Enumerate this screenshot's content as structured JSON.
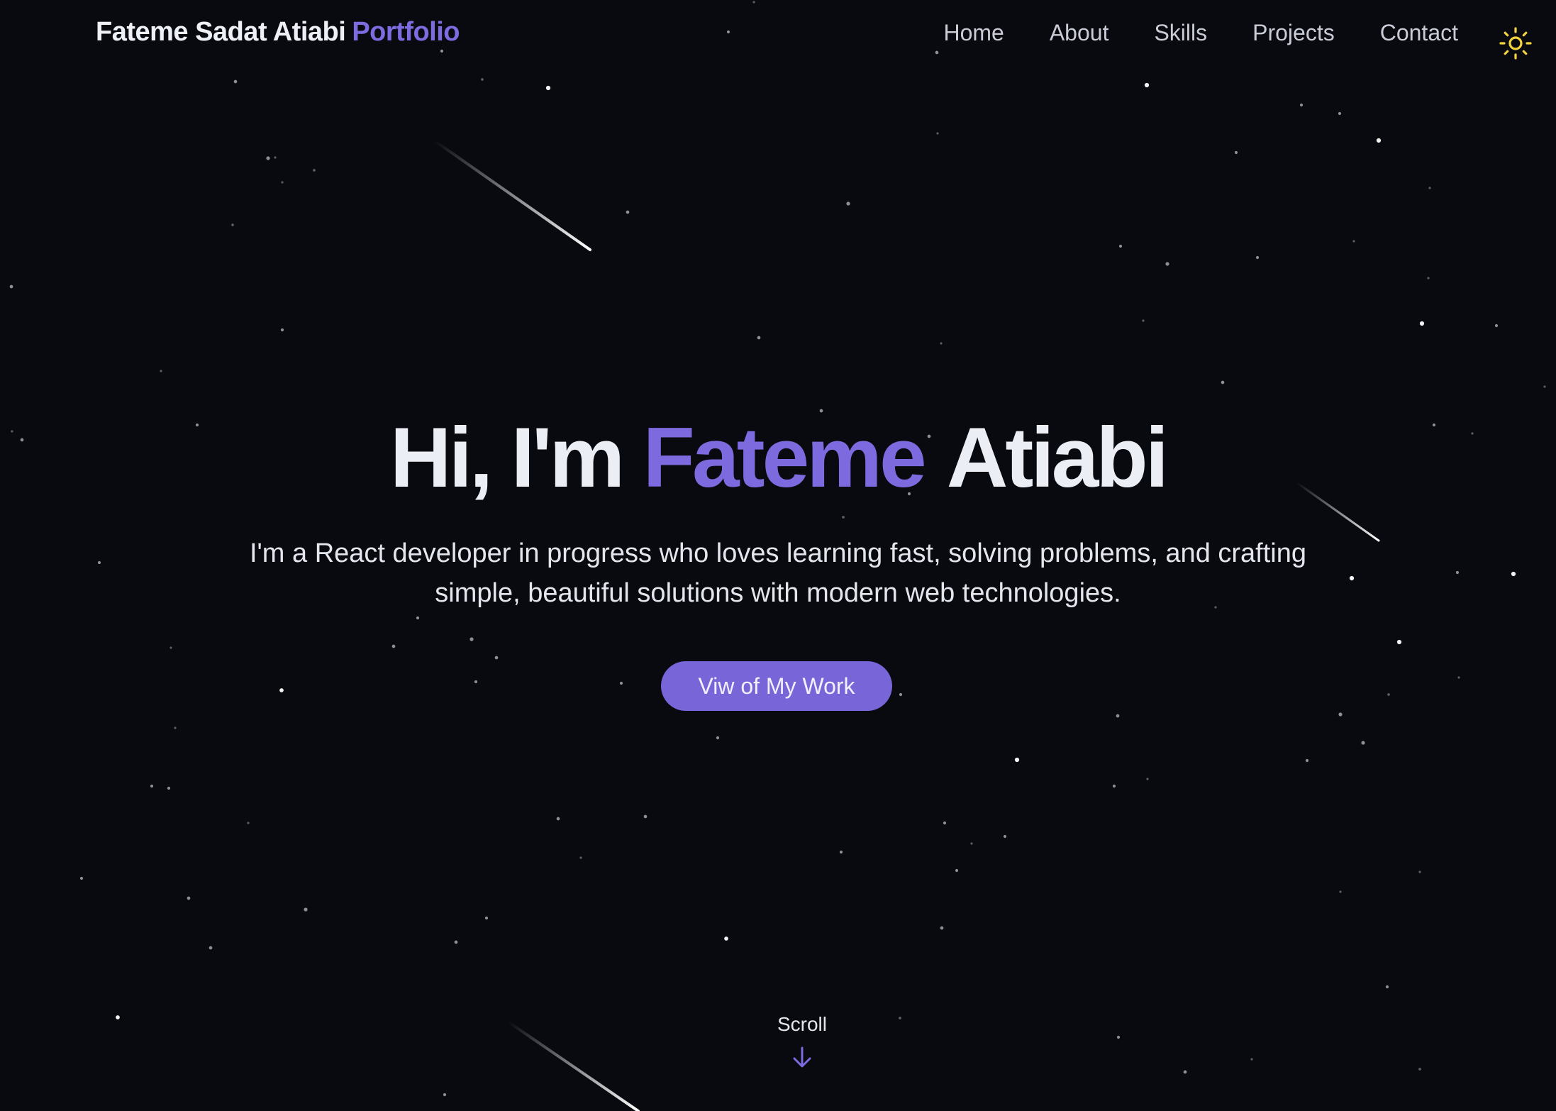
{
  "navbar": {
    "brand_name": "Fateme Sadat Atiabi",
    "brand_accent": "Portfolio",
    "links": [
      {
        "label": "Home"
      },
      {
        "label": "About"
      },
      {
        "label": "Skills"
      },
      {
        "label": "Projects"
      },
      {
        "label": "Contact"
      }
    ],
    "theme_toggle_icon": "sun-icon"
  },
  "hero": {
    "greeting": "Hi, I'm",
    "first_name": "Fateme",
    "last_name": "Atiabi",
    "subtitle": "I'm a React developer in progress who loves learning fast, solving problems, and crafting simple, beautiful solutions with modern web technologies.",
    "cta_label": "Viw of My Work"
  },
  "scroll": {
    "label": "Scroll",
    "icon": "arrow-down-icon"
  },
  "colors": {
    "background": "#090a10",
    "accent": "#7c6ade",
    "sun": "#f5d33d",
    "text": "#eceef5"
  }
}
